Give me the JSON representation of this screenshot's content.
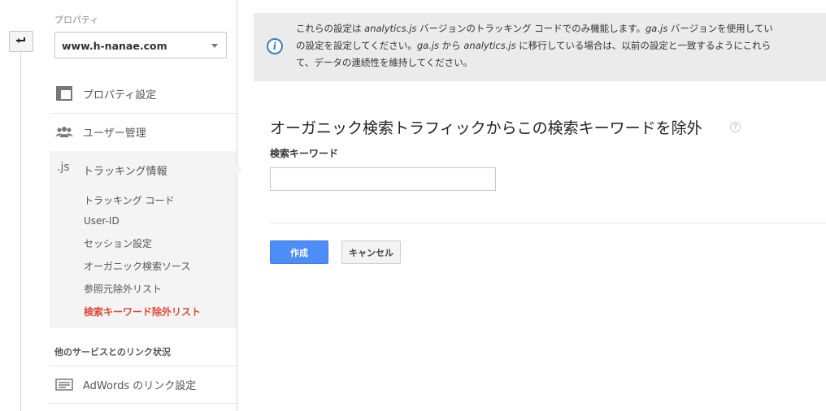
{
  "sidebar": {
    "property_label": "プロパティ",
    "property_value": "www.h-nanae.com",
    "items": [
      {
        "label": "プロパティ設定",
        "icon": "window-icon"
      },
      {
        "label": "ユーザー管理",
        "icon": "users-icon"
      },
      {
        "label": "トラッキング情報",
        "icon": "js-icon",
        "icon_text": ".js"
      }
    ],
    "tracking_subitems": [
      {
        "label": "トラッキング コード"
      },
      {
        "label": "User-ID"
      },
      {
        "label": "セッション設定"
      },
      {
        "label": "オーガニック検索ソース"
      },
      {
        "label": "参照元除外リスト"
      },
      {
        "label": "検索キーワード除外リスト",
        "active": true
      }
    ],
    "linking_section_title": "他のサービスとのリンク状況",
    "adwords_item": {
      "label": "AdWords のリンク設定",
      "icon": "adwords-icon"
    }
  },
  "info": {
    "line1_a": "これらの設定は ",
    "line1_b": "analytics.js",
    "line1_c": " バージョンのトラッキング コードでのみ機能します。",
    "line1_d": "ga.js",
    "line1_e": " バージョンを使用してい",
    "line2_a": "の設定を設定してください。",
    "line2_b": "ga.js",
    "line2_c": " から ",
    "line2_d": "analytics.js",
    "line2_e": " に移行している場合は、以前の設定と一致するようにこれら",
    "line3": "て、データの連続性を維持してください。"
  },
  "form": {
    "title": "オーガニック検索トラフィックからこの検索キーワードを除外",
    "field_label": "検索キーワード",
    "field_value": "",
    "create_label": "作成",
    "cancel_label": "キャンセル"
  },
  "colors": {
    "active": "#dd4b39",
    "primary_button": "#4c8ef6",
    "info_icon": "#3b7dc4"
  }
}
